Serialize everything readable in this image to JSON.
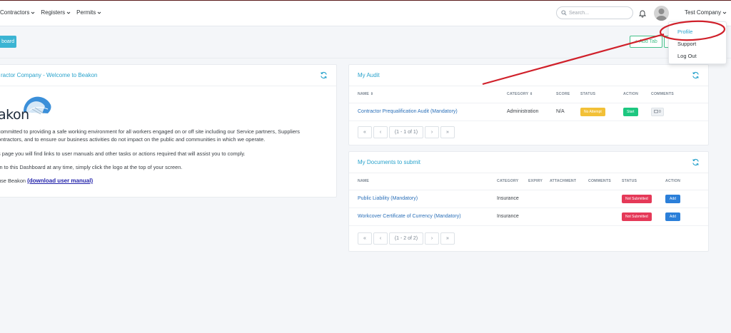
{
  "nav": [
    {
      "label": "Contractors"
    },
    {
      "label": "Registers"
    },
    {
      "label": "Permits"
    }
  ],
  "search": {
    "placeholder": "Search..."
  },
  "user": {
    "company": "Test Company"
  },
  "dropdown": {
    "items": [
      "Profile",
      "Support",
      "Log Out"
    ]
  },
  "subheader": {
    "dashboard_label": "board",
    "add_tab_label": "Add Tab"
  },
  "welcome": {
    "title": "ractor Company - Welcome to Beakon",
    "logo_text": "akon",
    "lines": [
      "committed to providing a safe working environment for all workers engaged on or off site including our Service partners, Suppliers",
      "ontractors, and to ensure our business activities do not impact on the public and communities in which we operate.",
      "s page you will find links to user manuals and other tasks or actions required that will assist you to comply.",
      "rn to this Dashboard at any time, simply click the logo at the top of your screen."
    ],
    "manual_prefix": "use Beakon ",
    "manual_link": "(download user manual)"
  },
  "audit": {
    "title": "My Audit",
    "columns": [
      "NAME ⇕",
      "CATEGORY ⇕",
      "SCORE",
      "STATUS",
      "ACTION",
      "COMMENTS"
    ],
    "rows": [
      {
        "name": "Contractor Prequalification Audit (Mandatory)",
        "category": "Administration",
        "score": "N/A",
        "status": "No Attempt",
        "action": "Start",
        "comments": "0"
      }
    ],
    "pager": "(1 - 1 of 1)"
  },
  "docs": {
    "title": "My Documents to submit",
    "columns": [
      "NAME",
      "CATEGORY",
      "EXPIRY",
      "ATTACHMENT",
      "COMMENTS",
      "STATUS",
      "ACTION"
    ],
    "rows": [
      {
        "name": "Public Liability (Mandatory)",
        "category": "Insurance",
        "status": "Not Submitted",
        "action": "Add"
      },
      {
        "name": "Workcover Certificate of Currency (Mandatory)",
        "category": "Insurance",
        "status": "Not Submitted",
        "action": "Add"
      }
    ],
    "pager": "(1 - 2 of 2)"
  },
  "pager_icons": {
    "first": "«",
    "prev": "‹",
    "next": "›",
    "last": "»"
  },
  "colors": {
    "accent": "#2aa3cc",
    "annotation": "#d0202a",
    "success": "#1dc780",
    "danger": "#e53958",
    "warning": "#f2c037",
    "primary": "#2b7fd9"
  }
}
